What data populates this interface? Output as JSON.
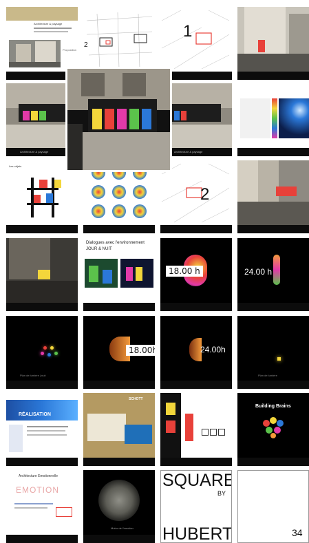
{
  "grid": {
    "r1c1": {
      "title": "Architecture & paysage",
      "caption": "Proposition"
    },
    "r1c2": {
      "marker": "2"
    },
    "r1c3": {
      "marker": "1"
    },
    "r2c1": {
      "caption": "Architecture & paysage"
    },
    "r2c3": {
      "caption": "Architecture & paysage"
    },
    "r3c1": {
      "label": "Les objets"
    },
    "r3c3": {
      "marker": "2"
    },
    "r4c2": {
      "title": "Dialogues avec l'environnement",
      "subtitle": "JOUR & NUIT"
    },
    "r4c3": {
      "time": "18.00 h"
    },
    "r4c4": {
      "time": "24.00 h"
    },
    "r5c1": {
      "caption": "Plan de lumière | nuit"
    },
    "r5c2": {
      "time": "18.00h"
    },
    "r5c3": {
      "time": "24.00h"
    },
    "r5c4": {
      "caption": "Plan de lumière"
    },
    "r6c1": {
      "label": "RÉALISATION"
    },
    "r6c2": {
      "title": "SCHOTT"
    },
    "r6c4": {
      "title": "Building Brains"
    },
    "r7c1": {
      "title": "Architecture Emotionnelle",
      "stamp": "EMOTION"
    },
    "r7c2": {
      "caption": "Motor de l'emotion"
    },
    "r7c3": {
      "line1": "SQUARE",
      "line2": "BY",
      "line3": "HUBERT"
    },
    "r7c4": {
      "page_number": "34"
    }
  },
  "colors": {
    "red": "#e8413a",
    "yellow": "#f3d63b",
    "blue": "#2b78d8",
    "green": "#5bc24b",
    "magenta": "#e23aa8",
    "orange": "#f39a3a"
  }
}
